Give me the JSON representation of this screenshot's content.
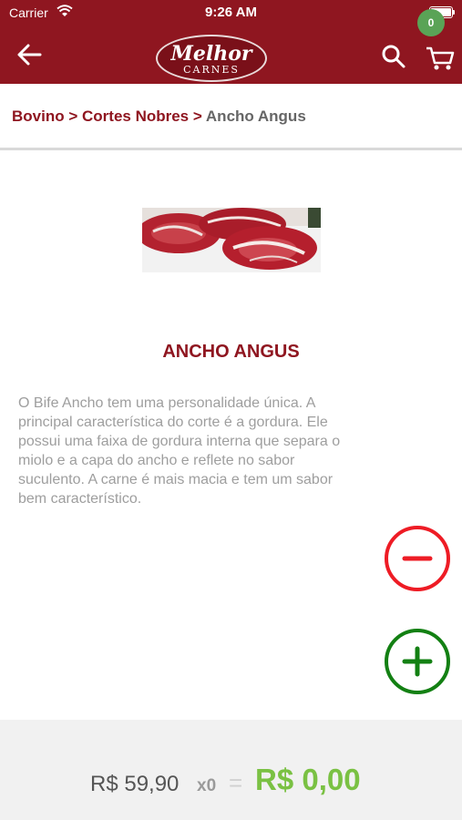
{
  "status_bar": {
    "carrier": "Carrier",
    "time": "9:26 AM"
  },
  "header": {
    "logo_main": "Melhor",
    "logo_sub": "CARNES",
    "cart_count": "0",
    "colors": {
      "bar": "#8f1620",
      "badge": "#5aa356"
    }
  },
  "breadcrumb": {
    "items": [
      "Bovino",
      "Cortes Nobres",
      "Ancho Angus"
    ],
    "separator": ">"
  },
  "product": {
    "title": "ANCHO ANGUS",
    "description": "O Bife Ancho tem uma personalidade única. A principal característica do corte é a gordura. Ele possui uma faixa de gordura interna que separa o miolo e a capa do ancho e reflete no sabor suculento. A carne é mais macia e tem um sabor bem característico.",
    "image_icon": "raw-steak-photo"
  },
  "actions": {
    "minus_icon": "minus-icon",
    "plus_icon": "plus-icon",
    "minus_color": "#ee1c25",
    "plus_color": "#138013"
  },
  "footer": {
    "unit_price": "R$ 59,90",
    "quantity": "x0",
    "equals": "=",
    "total": "R$ 0,00",
    "total_color": "#7ac143"
  }
}
